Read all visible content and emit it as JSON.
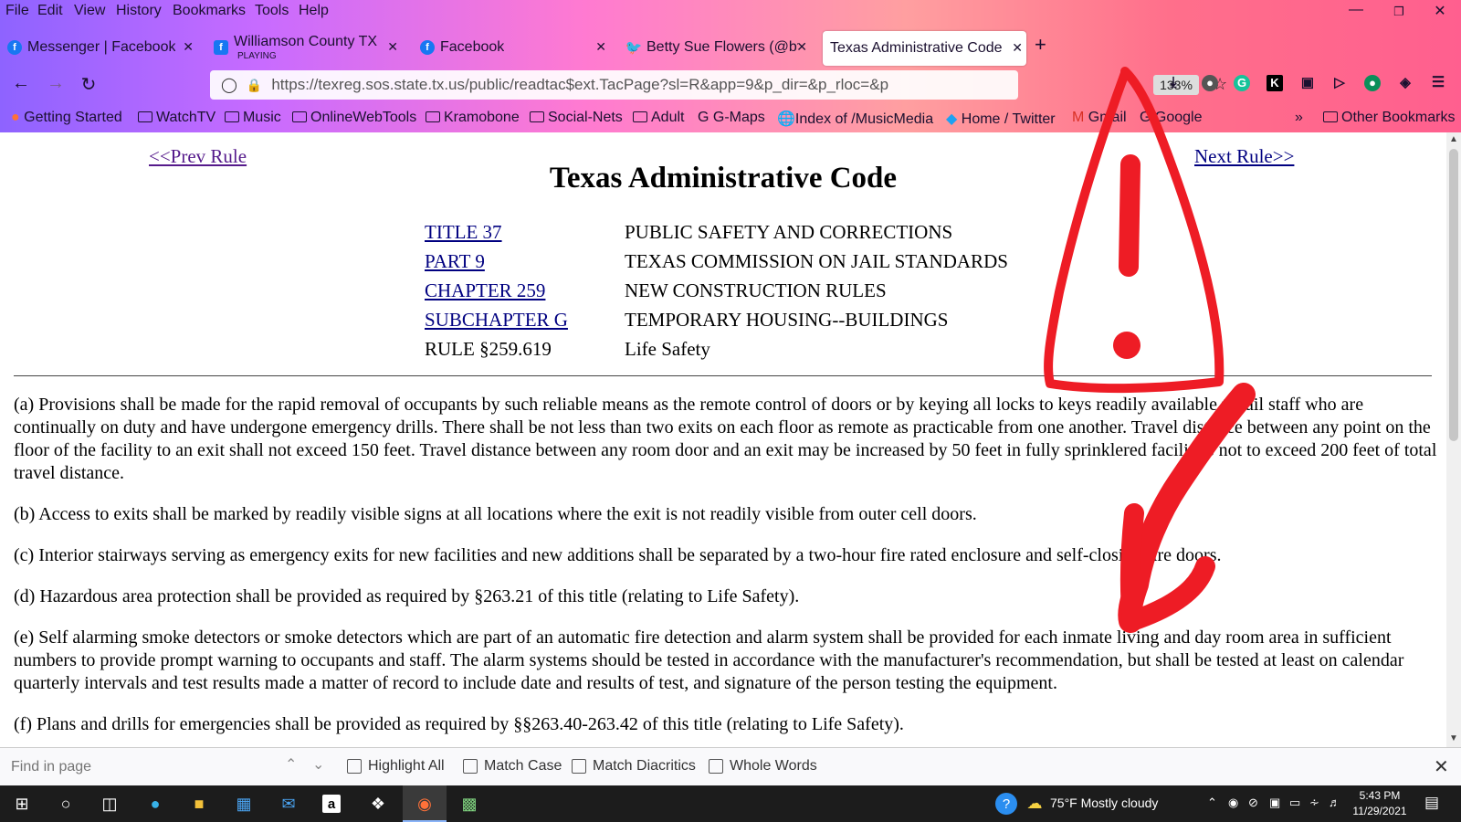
{
  "menu": [
    "File",
    "Edit",
    "View",
    "History",
    "Bookmarks",
    "Tools",
    "Help"
  ],
  "tabs": [
    {
      "title": "Messenger | Facebook",
      "icon": "facebook-icon",
      "color": "#1877f2"
    },
    {
      "title": "Williamson County TX, S",
      "subtitle": "PLAYING",
      "icon": "facebook-icon",
      "color": "#1877f2"
    },
    {
      "title": "Facebook",
      "icon": "facebook-icon",
      "color": "#1877f2"
    },
    {
      "title": "Betty Sue Flowers (@bf",
      "icon": "twitter-icon",
      "color": "#1da1f2"
    },
    {
      "title": "Texas Administrative Code",
      "active": true
    }
  ],
  "url": "https://texreg.sos.state.tx.us/public/readtac$ext.TacPage?sl=R&app=9&p_dir=&p_rloc=&p",
  "zoom": "133%",
  "bookmarks": [
    "Getting Started",
    "WatchTV",
    "Music",
    "OnlineWebTools",
    "Kramobone",
    "Social-Nets",
    "Adult",
    "G-Maps",
    "Index of /MusicMedia",
    "Home / Twitter",
    "Gmail",
    "Google",
    "Other Bookmarks"
  ],
  "page": {
    "prev": "<<Prev Rule",
    "next": "Next Rule>>",
    "title": "Texas Administrative Code",
    "hierarchy": [
      {
        "label": "TITLE 37",
        "value": "PUBLIC SAFETY AND CORRECTIONS",
        "link": true
      },
      {
        "label": "PART 9",
        "value": "TEXAS COMMISSION ON JAIL STANDARDS",
        "link": true
      },
      {
        "label": "CHAPTER 259",
        "value": "NEW CONSTRUCTION RULES",
        "link": true
      },
      {
        "label": "SUBCHAPTER G",
        "value": "TEMPORARY HOUSING--BUILDINGS",
        "link": true
      },
      {
        "label": "RULE §259.619",
        "value": "Life Safety",
        "link": false
      }
    ],
    "paragraphs": [
      "(a) Provisions shall be made for the rapid removal of occupants by such reliable means as the remote control of doors or by keying all locks to keys readily available to jail staff who are continually on duty and have undergone emergency drills. There shall be not less than two exits on each floor as remote as practicable from one another. Travel distance between any point on the floor of the facility to an exit shall not exceed 150 feet. Travel distance between any room door and an exit may be increased by 50 feet in fully sprinklered facilities not to exceed 200 feet of total travel distance.",
      "(b) Access to exits shall be marked by readily visible signs at all locations where the exit is not readily visible from outer cell doors.",
      "(c) Interior stairways serving as emergency exits for new facilities and new additions shall be separated by a two-hour fire rated enclosure and self-closing fire doors.",
      "(d) Hazardous area protection shall be provided as required by §263.21 of this title (relating to Life Safety).",
      "(e) Self alarming smoke detectors or smoke detectors which are part of an automatic fire detection and alarm system shall be provided for each inmate living and day room area in sufficient numbers to provide prompt warning to occupants and staff. The alarm systems should be tested in accordance with the manufacturer's recommendation, but shall be tested at least on calendar quarterly intervals and test results made a matter of record to include date and results of test, and signature of the person testing the equipment.",
      "(f) Plans and drills for emergencies shall be provided as required by §§263.40-263.42 of this title (relating to Life Safety)."
    ]
  },
  "findbar": {
    "placeholder": "Find in page",
    "options": [
      "Highlight All",
      "Match Case",
      "Match Diacritics",
      "Whole Words"
    ]
  },
  "taskbar": {
    "weather": "75°F  Mostly cloudy",
    "time": "5:43 PM",
    "date": "11/29/2021"
  }
}
